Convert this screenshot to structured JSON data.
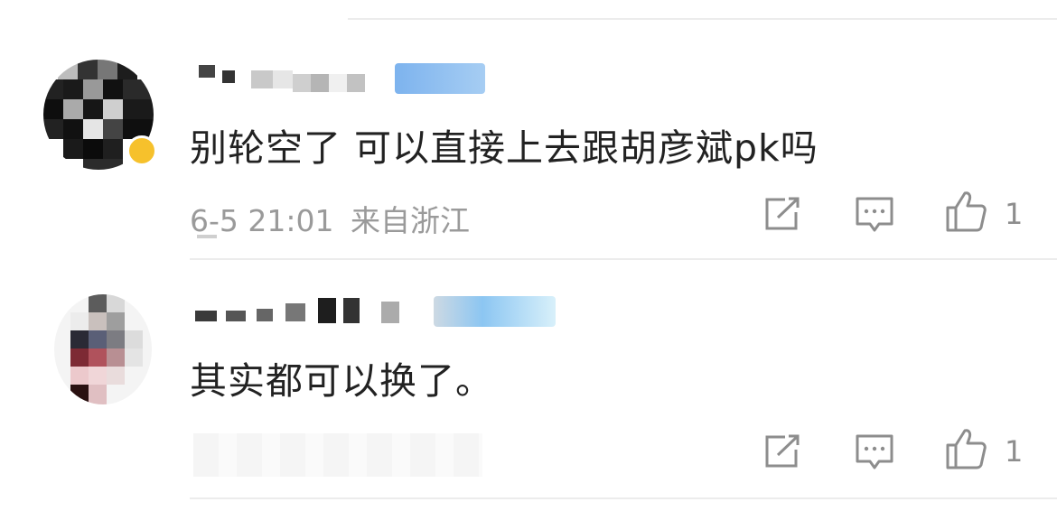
{
  "comments": [
    {
      "text": "别轮空了 可以直接上去跟胡彦斌pk吗",
      "time": "6-5 21:01",
      "location": "来自浙江",
      "likes": "1",
      "avatar_color": "#1a1a1a"
    },
    {
      "text": "其实都可以换了。",
      "time": "",
      "location": "",
      "likes": "1",
      "avatar_color": "#8a7070"
    }
  ],
  "icons": {
    "share": "share-icon",
    "reply": "reply-icon",
    "like": "thumbs-up-icon"
  },
  "colors": {
    "text": "#222222",
    "meta": "#9a9a9a",
    "icon": "#8d8d8d",
    "divider": "#ececec"
  }
}
